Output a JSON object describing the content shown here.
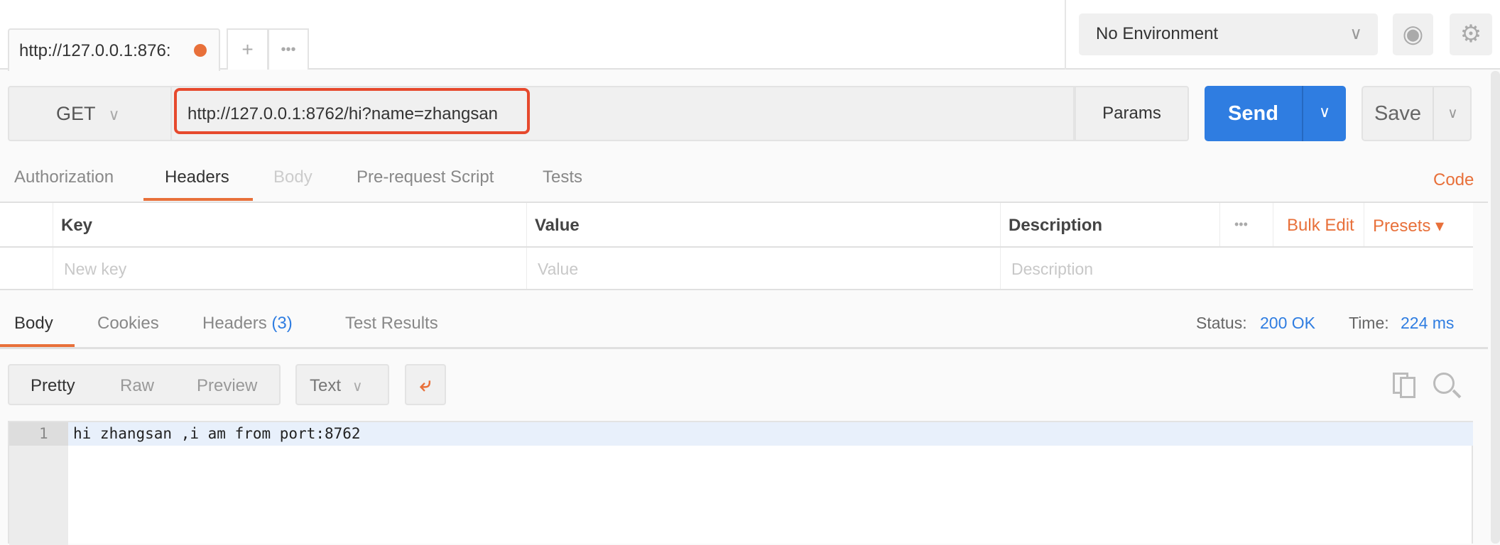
{
  "tabs": {
    "active_label": "http://127.0.0.1:876:",
    "unsaved_dot_color": "#e8703a",
    "new_tab": "+",
    "more": "•••"
  },
  "environment": {
    "selected": "No Environment",
    "chevron": "chevron-down-icon",
    "eye": "eye-icon",
    "gear": "gear-icon"
  },
  "request": {
    "method": "GET",
    "url": "http://127.0.0.1:8762/hi?name=zhangsan",
    "params_label": "Params",
    "send_label": "Send",
    "save_label": "Save",
    "send_color": "#2f7de1",
    "highlight_color": "#e6492d"
  },
  "request_tabs": {
    "items": [
      "Authorization",
      "Headers",
      "Body",
      "Pre-request Script",
      "Tests"
    ],
    "active": "Headers",
    "code_link": "Code"
  },
  "headers_table": {
    "columns": [
      "Key",
      "Value",
      "Description"
    ],
    "more": "•••",
    "bulk_edit": "Bulk Edit",
    "presets": "Presets ▾",
    "placeholders": {
      "key": "New key",
      "value": "Value",
      "description": "Description"
    }
  },
  "response": {
    "tabs": [
      "Body",
      "Cookies",
      "Headers",
      "Test Results"
    ],
    "headers_count": "(3)",
    "active": "Body",
    "status_label": "Status:",
    "status_value": "200 OK",
    "time_label": "Time:",
    "time_value": "224 ms",
    "format_modes": [
      "Pretty",
      "Raw",
      "Preview"
    ],
    "active_mode": "Pretty",
    "type": "Text",
    "lines": [
      {
        "number": "1",
        "text": "hi zhangsan ,i am from port:8762"
      }
    ]
  },
  "accent_color": "#e8703a"
}
